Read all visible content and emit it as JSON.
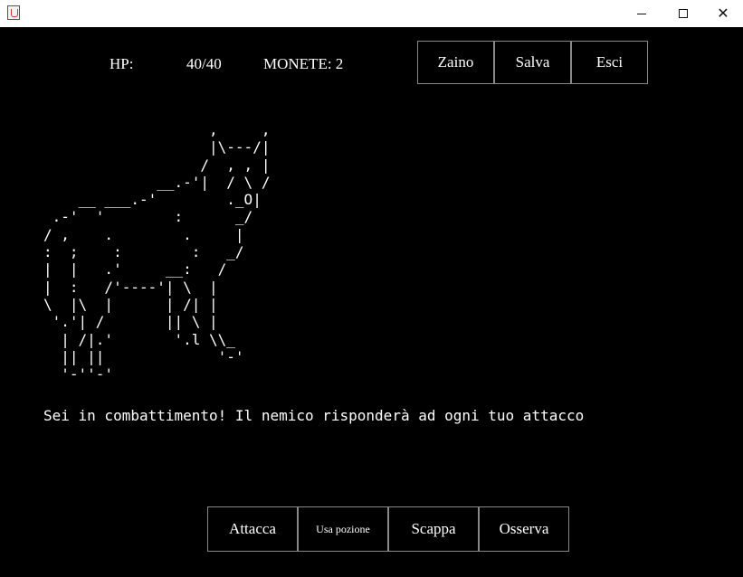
{
  "window": {
    "minimize_icon": "minimize-icon",
    "maximize_icon": "maximize-icon",
    "close_label": "✕"
  },
  "status": {
    "hp_label": "HP:",
    "hp_value": "40/40",
    "coins": "MONETE: 2"
  },
  "top_buttons": {
    "backpack": "Zaino",
    "save": "Salva",
    "exit": "Esci"
  },
  "scene": {
    "ascii_art": "                   ,     ,\n                   |\\---/|\n                  /  , , |\n             __.-'|  / \\ /\n    __ ___.-'        ._O|\n .-'  '        :      _/\n/ ,    .        .     |\n:  ;    :        :   _/\n|  |   .'     __:   /\n|  :   /'----'| \\  |\n\\  |\\  |      | /| |\n '.'| /       || \\ |\n  | /|.'       '.l \\\\_\n  || ||             '-'\n  '-''-'",
    "message": "Sei in combattimento! Il nemico risponderà ad ogni tuo attacco"
  },
  "bottom_buttons": {
    "attack": "Attacca",
    "potion": "Usa pozione",
    "flee": "Scappa",
    "observe": "Osserva"
  }
}
